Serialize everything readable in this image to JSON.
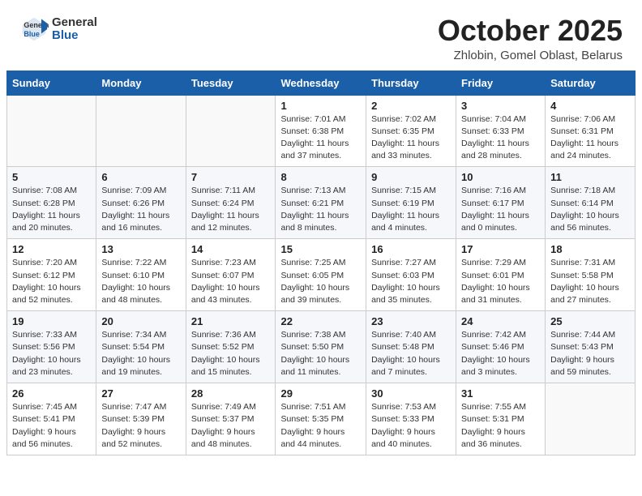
{
  "header": {
    "logo_general": "General",
    "logo_blue": "Blue",
    "month_title": "October 2025",
    "location": "Zhlobin, Gomel Oblast, Belarus"
  },
  "days_of_week": [
    "Sunday",
    "Monday",
    "Tuesday",
    "Wednesday",
    "Thursday",
    "Friday",
    "Saturday"
  ],
  "weeks": [
    [
      {
        "day": "",
        "info": ""
      },
      {
        "day": "",
        "info": ""
      },
      {
        "day": "",
        "info": ""
      },
      {
        "day": "1",
        "info": "Sunrise: 7:01 AM\nSunset: 6:38 PM\nDaylight: 11 hours\nand 37 minutes."
      },
      {
        "day": "2",
        "info": "Sunrise: 7:02 AM\nSunset: 6:35 PM\nDaylight: 11 hours\nand 33 minutes."
      },
      {
        "day": "3",
        "info": "Sunrise: 7:04 AM\nSunset: 6:33 PM\nDaylight: 11 hours\nand 28 minutes."
      },
      {
        "day": "4",
        "info": "Sunrise: 7:06 AM\nSunset: 6:31 PM\nDaylight: 11 hours\nand 24 minutes."
      }
    ],
    [
      {
        "day": "5",
        "info": "Sunrise: 7:08 AM\nSunset: 6:28 PM\nDaylight: 11 hours\nand 20 minutes."
      },
      {
        "day": "6",
        "info": "Sunrise: 7:09 AM\nSunset: 6:26 PM\nDaylight: 11 hours\nand 16 minutes."
      },
      {
        "day": "7",
        "info": "Sunrise: 7:11 AM\nSunset: 6:24 PM\nDaylight: 11 hours\nand 12 minutes."
      },
      {
        "day": "8",
        "info": "Sunrise: 7:13 AM\nSunset: 6:21 PM\nDaylight: 11 hours\nand 8 minutes."
      },
      {
        "day": "9",
        "info": "Sunrise: 7:15 AM\nSunset: 6:19 PM\nDaylight: 11 hours\nand 4 minutes."
      },
      {
        "day": "10",
        "info": "Sunrise: 7:16 AM\nSunset: 6:17 PM\nDaylight: 11 hours\nand 0 minutes."
      },
      {
        "day": "11",
        "info": "Sunrise: 7:18 AM\nSunset: 6:14 PM\nDaylight: 10 hours\nand 56 minutes."
      }
    ],
    [
      {
        "day": "12",
        "info": "Sunrise: 7:20 AM\nSunset: 6:12 PM\nDaylight: 10 hours\nand 52 minutes."
      },
      {
        "day": "13",
        "info": "Sunrise: 7:22 AM\nSunset: 6:10 PM\nDaylight: 10 hours\nand 48 minutes."
      },
      {
        "day": "14",
        "info": "Sunrise: 7:23 AM\nSunset: 6:07 PM\nDaylight: 10 hours\nand 43 minutes."
      },
      {
        "day": "15",
        "info": "Sunrise: 7:25 AM\nSunset: 6:05 PM\nDaylight: 10 hours\nand 39 minutes."
      },
      {
        "day": "16",
        "info": "Sunrise: 7:27 AM\nSunset: 6:03 PM\nDaylight: 10 hours\nand 35 minutes."
      },
      {
        "day": "17",
        "info": "Sunrise: 7:29 AM\nSunset: 6:01 PM\nDaylight: 10 hours\nand 31 minutes."
      },
      {
        "day": "18",
        "info": "Sunrise: 7:31 AM\nSunset: 5:58 PM\nDaylight: 10 hours\nand 27 minutes."
      }
    ],
    [
      {
        "day": "19",
        "info": "Sunrise: 7:33 AM\nSunset: 5:56 PM\nDaylight: 10 hours\nand 23 minutes."
      },
      {
        "day": "20",
        "info": "Sunrise: 7:34 AM\nSunset: 5:54 PM\nDaylight: 10 hours\nand 19 minutes."
      },
      {
        "day": "21",
        "info": "Sunrise: 7:36 AM\nSunset: 5:52 PM\nDaylight: 10 hours\nand 15 minutes."
      },
      {
        "day": "22",
        "info": "Sunrise: 7:38 AM\nSunset: 5:50 PM\nDaylight: 10 hours\nand 11 minutes."
      },
      {
        "day": "23",
        "info": "Sunrise: 7:40 AM\nSunset: 5:48 PM\nDaylight: 10 hours\nand 7 minutes."
      },
      {
        "day": "24",
        "info": "Sunrise: 7:42 AM\nSunset: 5:46 PM\nDaylight: 10 hours\nand 3 minutes."
      },
      {
        "day": "25",
        "info": "Sunrise: 7:44 AM\nSunset: 5:43 PM\nDaylight: 9 hours\nand 59 minutes."
      }
    ],
    [
      {
        "day": "26",
        "info": "Sunrise: 7:45 AM\nSunset: 5:41 PM\nDaylight: 9 hours\nand 56 minutes."
      },
      {
        "day": "27",
        "info": "Sunrise: 7:47 AM\nSunset: 5:39 PM\nDaylight: 9 hours\nand 52 minutes."
      },
      {
        "day": "28",
        "info": "Sunrise: 7:49 AM\nSunset: 5:37 PM\nDaylight: 9 hours\nand 48 minutes."
      },
      {
        "day": "29",
        "info": "Sunrise: 7:51 AM\nSunset: 5:35 PM\nDaylight: 9 hours\nand 44 minutes."
      },
      {
        "day": "30",
        "info": "Sunrise: 7:53 AM\nSunset: 5:33 PM\nDaylight: 9 hours\nand 40 minutes."
      },
      {
        "day": "31",
        "info": "Sunrise: 7:55 AM\nSunset: 5:31 PM\nDaylight: 9 hours\nand 36 minutes."
      },
      {
        "day": "",
        "info": ""
      }
    ]
  ]
}
